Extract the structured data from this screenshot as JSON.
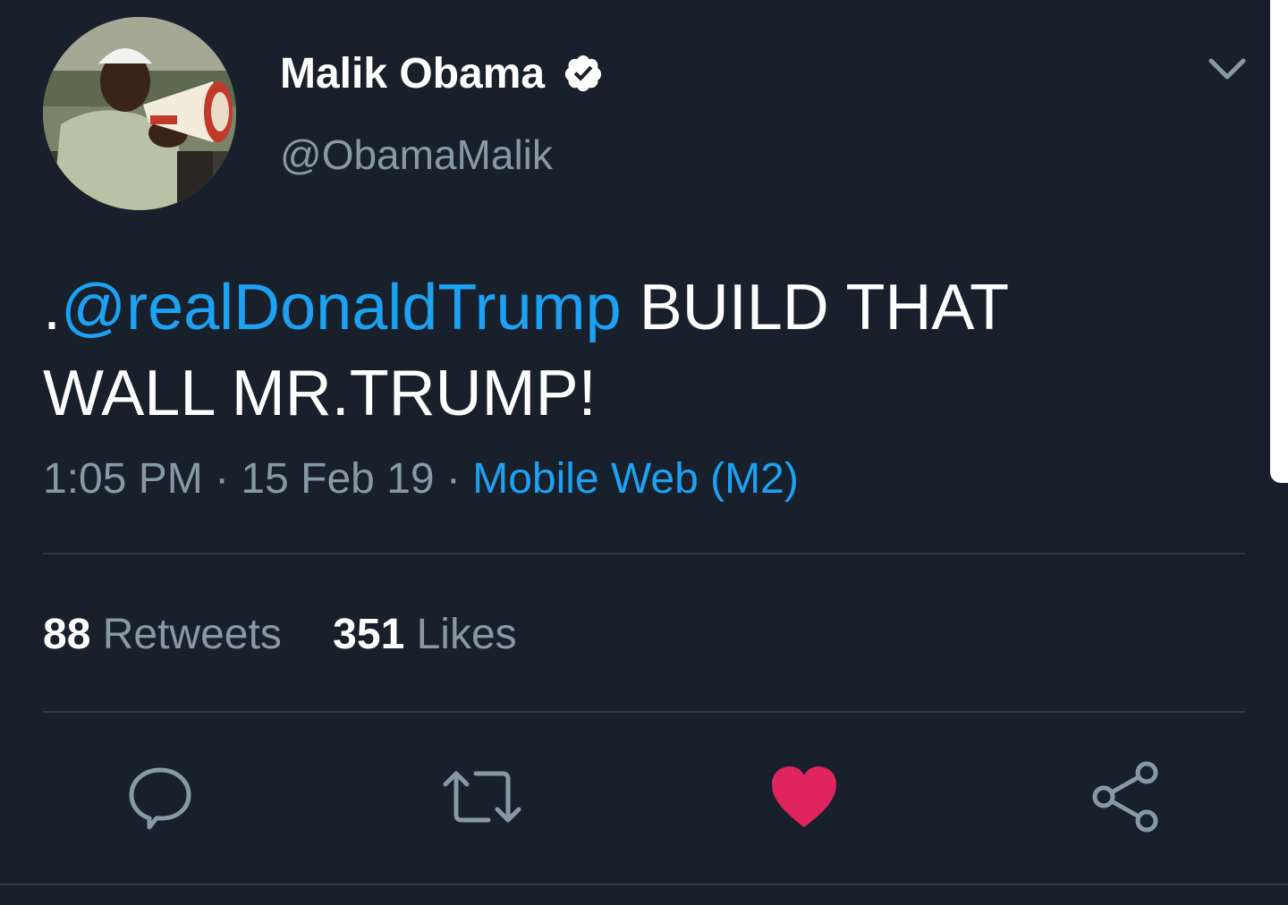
{
  "user": {
    "display_name": "Malik Obama",
    "handle": "@ObamaMalik",
    "verified": true
  },
  "tweet": {
    "prefix": ".",
    "mention": "@realDonaldTrump",
    "text_line1": " BUILD THAT",
    "text_line2": "WALL MR.TRUMP!"
  },
  "meta": {
    "time": "1:05 PM",
    "sep1": " · ",
    "date": "15 Feb 19",
    "sep2": " · ",
    "source": "Mobile Web (M2)"
  },
  "stats": {
    "retweets_count": "88",
    "retweets_label": "Retweets",
    "likes_count": "351",
    "likes_label": "Likes"
  },
  "actions": [
    {
      "icon": "reply-icon"
    },
    {
      "icon": "retweet-icon"
    },
    {
      "icon": "heart-icon",
      "active": true
    },
    {
      "icon": "share-icon"
    }
  ],
  "colors": {
    "background": "#18202b",
    "link": "#1da1f2",
    "secondary_text": "#8899a6",
    "like": "#e0245e",
    "divider": "#2f3943"
  }
}
